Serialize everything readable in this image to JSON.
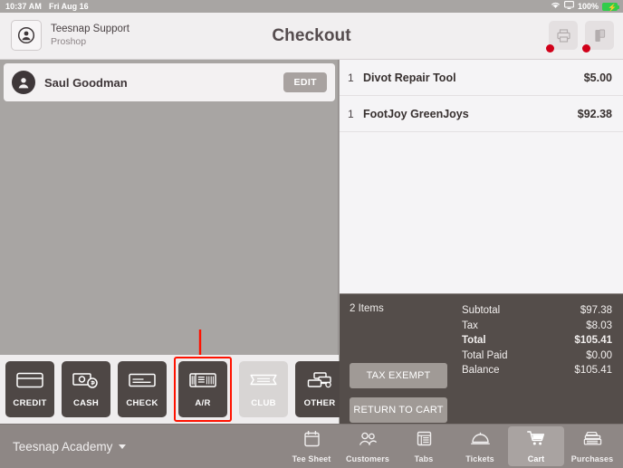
{
  "statusbar": {
    "time": "10:37 AM",
    "date": "Fri Aug 16",
    "battery_pct": "100%",
    "wifi_icon": "wifi-icon",
    "airplay_icon": "airplay-icon",
    "battery_icon": "battery-charging-icon"
  },
  "header": {
    "title": "Checkout",
    "user_name": "Teesnap Support",
    "user_role": "Proshop",
    "avatar_icon": "user-circle-icon",
    "actions": [
      {
        "name": "printer-button",
        "icon": "printer-icon",
        "has_alert": true
      },
      {
        "name": "card-reader-button",
        "icon": "card-reader-icon",
        "has_alert": true
      }
    ]
  },
  "customer": {
    "name": "Saul Goodman",
    "edit_label": "EDIT",
    "avatar_icon": "user-avatar-icon"
  },
  "annotation": {
    "arrow": "red-down-arrow",
    "arrow_color": "#ff1100",
    "highlight_target": "A/R",
    "highlight_color": "#ff1100"
  },
  "payment_methods": [
    {
      "label": "CREDIT",
      "icon": "credit-card-icon",
      "state": "enabled",
      "highlighted": false
    },
    {
      "label": "CASH",
      "icon": "cash-coin-icon",
      "state": "enabled",
      "highlighted": false
    },
    {
      "label": "CHECK",
      "icon": "check-icon",
      "state": "enabled",
      "highlighted": false
    },
    {
      "label": "A/R",
      "icon": "invoice-icon",
      "state": "enabled",
      "highlighted": true
    },
    {
      "label": "CLUB",
      "icon": "ticket-icon",
      "state": "disabled",
      "highlighted": false
    },
    {
      "label": "OTHER",
      "icon": "cards-stack-icon",
      "state": "enabled",
      "highlighted": false
    }
  ],
  "cart": {
    "items": [
      {
        "qty": "1",
        "name": "Divot Repair Tool",
        "price": "$5.00"
      },
      {
        "qty": "1",
        "name": "FootJoy GreenJoys",
        "price": "$92.38"
      }
    ]
  },
  "totals": {
    "items_count": "2 Items",
    "tax_exempt_label": "TAX EXEMPT",
    "return_to_cart_label": "RETURN TO CART",
    "lines": [
      {
        "label": "Subtotal",
        "value": "$97.38",
        "bold": false
      },
      {
        "label": "Tax",
        "value": "$8.03",
        "bold": false
      },
      {
        "label": "Total",
        "value": "$105.41",
        "bold": true
      },
      {
        "label": "Total Paid",
        "value": "$0.00",
        "bold": false
      },
      {
        "label": "Balance",
        "value": "$105.41",
        "bold": false
      }
    ]
  },
  "bottombar": {
    "academy_label": "Teesnap Academy",
    "nav": [
      {
        "label": "Tee Sheet",
        "icon": "calendar-icon",
        "active": false
      },
      {
        "label": "Customers",
        "icon": "people-icon",
        "active": false
      },
      {
        "label": "Tabs",
        "icon": "tabs-grid-icon",
        "active": false
      },
      {
        "label": "Tickets",
        "icon": "food-cloche-icon",
        "active": false
      },
      {
        "label": "Cart",
        "icon": "shopping-cart-icon",
        "active": true
      },
      {
        "label": "Purchases",
        "icon": "cash-register-icon",
        "active": false
      }
    ]
  },
  "colors": {
    "panel_gray": "#a8a5a3",
    "header_bg": "#f1eff0",
    "totals_bg": "#544d4a",
    "pay_btn": "#4e4745",
    "accent_red": "#ff1100",
    "alert_dot": "#d10019",
    "battery_green": "#31cc4a"
  }
}
